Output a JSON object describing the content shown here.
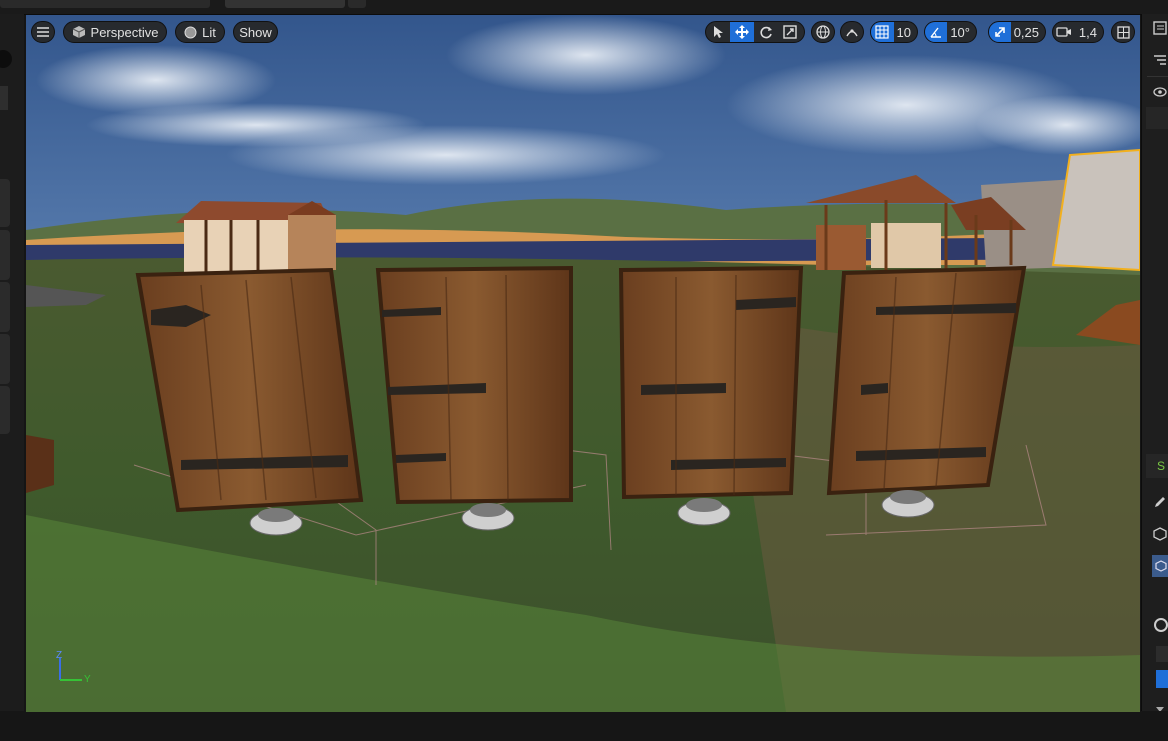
{
  "viewport_toolbar": {
    "menu_icon": "hamburger-menu-icon",
    "perspective_label": "Perspective",
    "lit_label": "Lit",
    "show_label": "Show",
    "grid_snap_value": "10",
    "rotation_snap_value": "10°",
    "scale_snap_value": "0,25",
    "camera_speed_value": "1,4"
  },
  "axis_gizmo": {
    "z": "Z",
    "y": "Y"
  },
  "colors": {
    "accent_blue": "#1f6fd8",
    "selection_outline": "#f2b01e",
    "panel_bg": "#1c1c1c"
  },
  "right_panel": {
    "partial_label": "S"
  }
}
